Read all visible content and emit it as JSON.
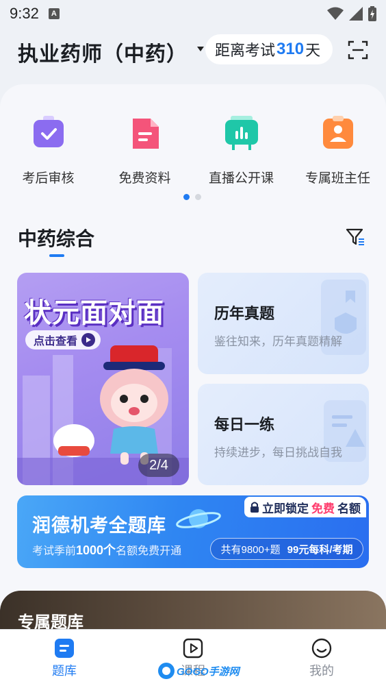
{
  "status_bar": {
    "time": "9:32",
    "notif_badge": "A"
  },
  "header": {
    "title": "执业药师（中药）",
    "exam_prefix": "距离考试",
    "exam_days": "310",
    "exam_suffix": "天",
    "scan_icon": "scan-icon"
  },
  "quick_actions": [
    {
      "label": "考后审核",
      "icon": "checkmark-card-icon",
      "color": "#8b6cf0"
    },
    {
      "label": "免费资料",
      "icon": "document-icon",
      "color": "#f4547a"
    },
    {
      "label": "直播公开课",
      "icon": "live-tv-icon",
      "color": "#1fc7a8"
    },
    {
      "label": "专属班主任",
      "icon": "teacher-badge-icon",
      "color": "#ff8a3d"
    }
  ],
  "pager": {
    "active_index": 0,
    "count": 2
  },
  "section": {
    "title": "中药综合",
    "filter_icon": "filter-icon"
  },
  "banner": {
    "title": "状元面对面",
    "button_label": "点击查看",
    "page_indicator": "2/4"
  },
  "cards": [
    {
      "title": "历年真题",
      "subtitle": "鉴往知来，历年真题精解"
    },
    {
      "title": "每日一练",
      "subtitle": "持续进步，每日挑战自我"
    }
  ],
  "promo": {
    "title": "润德机考全题库",
    "sub_prefix": "考试季前",
    "sub_highlight": "1000个",
    "sub_suffix": "名额免费开通",
    "lock_prefix": "立即锁定",
    "lock_highlight": "免费",
    "lock_suffix": "名额",
    "pill_left": "共有9800+题",
    "pill_right": "99元每科/考期"
  },
  "dark_section": {
    "title": "专属题库"
  },
  "bottom_nav": [
    {
      "label": "题库",
      "icon": "question-bank-icon",
      "active": true
    },
    {
      "label": "课程",
      "icon": "play-video-icon",
      "active": false
    },
    {
      "label": "我的",
      "icon": "smile-face-icon",
      "active": false
    }
  ],
  "watermark": {
    "text": "GOGO手游网"
  },
  "colors": {
    "accent": "#1f7bf2",
    "highlight": "#ff3d6e"
  }
}
